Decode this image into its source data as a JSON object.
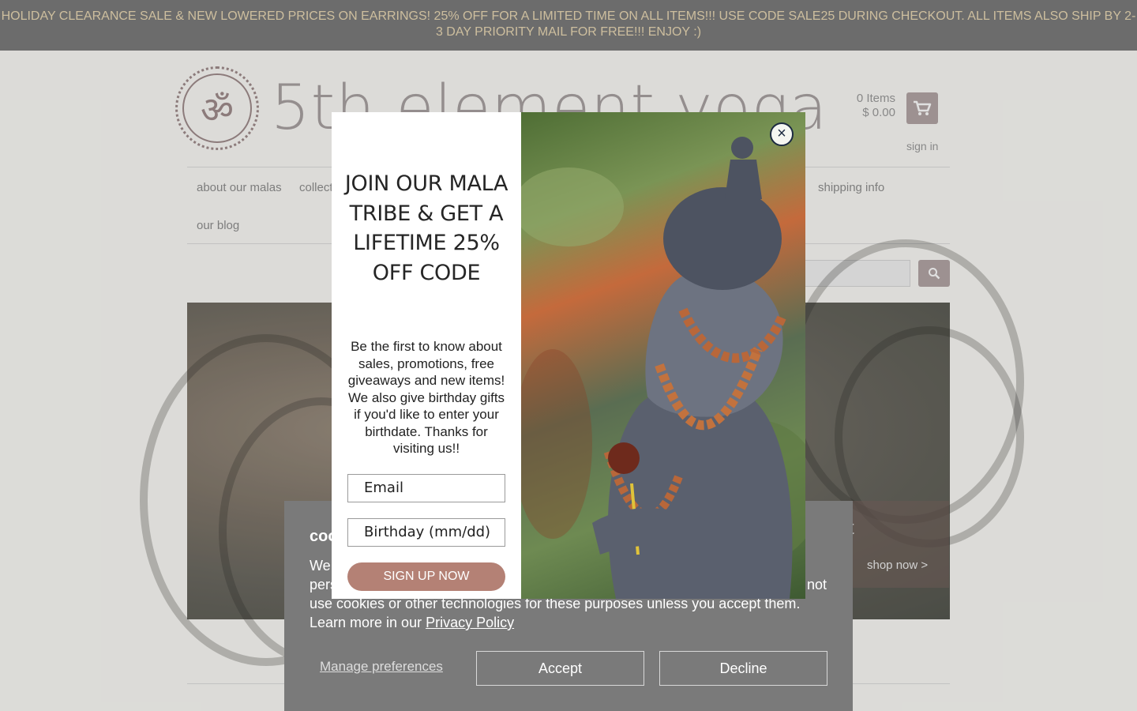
{
  "announcement": "HOLIDAY CLEARANCE SALE & NEW LOWERED PRICES ON EARRINGS! 25% OFF FOR A LIMITED TIME ON ALL ITEMS!!! USE CODE SALE25 DURING CHECKOUT. ALL ITEMS ALSO SHIP BY 2-3 DAY PRIORITY MAIL FOR FREE!!! ENJOY :)",
  "header": {
    "logo_glyph": "ॐ",
    "site_name": "5th element yoga",
    "cart_items": "0 Items",
    "cart_total": "$ 0.00",
    "signin": "sign in"
  },
  "nav": {
    "items": [
      "about our malas",
      "collect",
      "shipping info",
      "our blog"
    ]
  },
  "hero": {
    "title_fragment": "t",
    "shop_now": "shop now >"
  },
  "cookie": {
    "title": "coo",
    "text_line1": "We",
    "text_line2": "pers",
    "text_not": "not",
    "text_line3": "use cookies or other technologies for these purposes unless you accept them.",
    "text_line4_prefix": "Learn more in our ",
    "privacy_link": "Privacy Policy",
    "manage": "Manage preferences",
    "accept": "Accept",
    "decline": "Decline"
  },
  "popup": {
    "heading": "JOIN OUR MALA TRIBE & GET A LIFETIME 25% OFF CODE",
    "body": "Be the first to know about sales, promotions, free giveaways and new items! We also give birthday gifts if you'd like to enter your birthdate. Thanks for visiting us!!",
    "email_placeholder": "Email",
    "birthday_placeholder": "Birthday (mm/dd)",
    "signup": "SIGN UP NOW",
    "close": "×"
  },
  "colors": {
    "announce_bg": "#7c7c7c",
    "announce_text": "#ead9b4",
    "accent": "#b48175",
    "cookie_bg": "#7a7a7a"
  }
}
